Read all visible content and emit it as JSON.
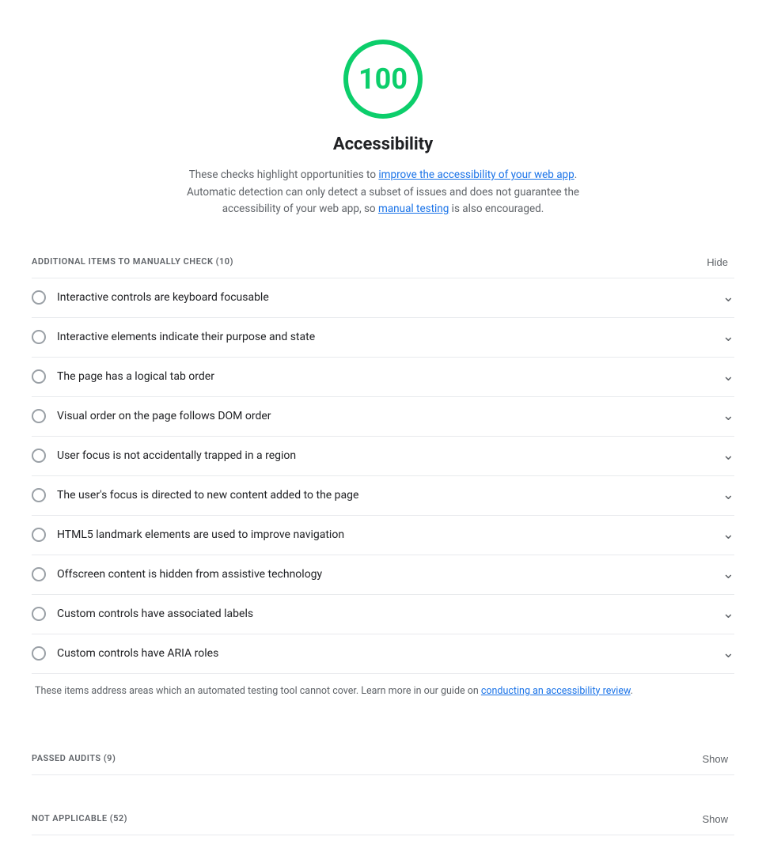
{
  "score": {
    "value": "100",
    "label": "Accessibility",
    "description_part1": "These checks highlight opportunities to ",
    "link1_text": "improve the accessibility of your web app",
    "description_part2": ". Automatic detection can only detect a subset of issues and does not guarantee the accessibility of your web app, so ",
    "link2_text": "manual testing",
    "description_part3": " is also encouraged."
  },
  "manual_section": {
    "label": "ADDITIONAL ITEMS TO MANUALLY CHECK",
    "count": "(10)",
    "toggle_label": "Hide"
  },
  "audit_items": [
    {
      "id": "item-1",
      "label": "Interactive controls are keyboard focusable"
    },
    {
      "id": "item-2",
      "label": "Interactive elements indicate their purpose and state"
    },
    {
      "id": "item-3",
      "label": "The page has a logical tab order"
    },
    {
      "id": "item-4",
      "label": "Visual order on the page follows DOM order"
    },
    {
      "id": "item-5",
      "label": "User focus is not accidentally trapped in a region"
    },
    {
      "id": "item-6",
      "label": "The user's focus is directed to new content added to the page"
    },
    {
      "id": "item-7",
      "label": "HTML5 landmark elements are used to improve navigation"
    },
    {
      "id": "item-8",
      "label": "Offscreen content is hidden from assistive technology"
    },
    {
      "id": "item-9",
      "label": "Custom controls have associated labels"
    },
    {
      "id": "item-10",
      "label": "Custom controls have ARIA roles"
    }
  ],
  "manual_note_part1": "These items address areas which an automated testing tool cannot cover. Learn more in our guide on ",
  "manual_note_link": "conducting an accessibility review",
  "manual_note_part2": ".",
  "passed_section": {
    "label": "PASSED AUDITS",
    "count": "(9)",
    "toggle_label": "Show"
  },
  "not_applicable_section": {
    "label": "NOT APPLICABLE",
    "count": "(52)",
    "toggle_label": "Show"
  }
}
